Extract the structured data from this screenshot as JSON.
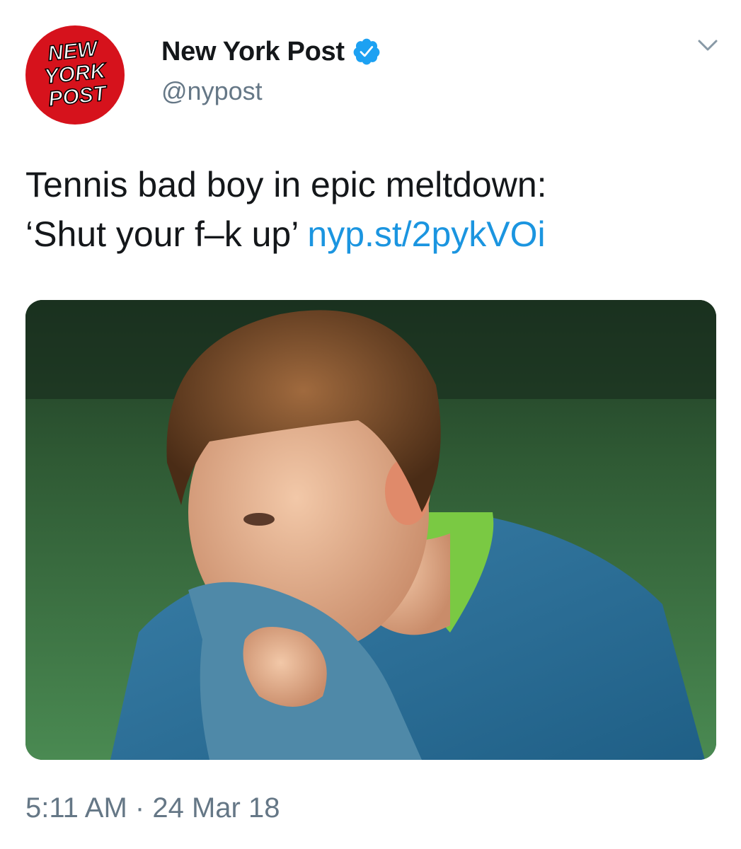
{
  "account": {
    "display_name": "New York Post",
    "handle": "@nypost",
    "verified": true,
    "avatar_logo_lines": [
      "NEW",
      "YORK",
      "POST"
    ]
  },
  "tweet": {
    "text_line1": "Tennis bad boy in epic meltdown:",
    "text_line2": "‘Shut your f–k up’",
    "link": "nyp.st/2pykVOi"
  },
  "meta": {
    "time": "5:11 AM",
    "separator": "·",
    "date": "24 Mar 18"
  },
  "icons": {
    "verified": "verified-badge-icon",
    "menu": "chevron-down-icon"
  },
  "colors": {
    "brand_red": "#d6121c",
    "link_blue": "#1b95e0",
    "verified_blue": "#1da1f2",
    "text_primary": "#14171a",
    "text_secondary": "#657786"
  }
}
